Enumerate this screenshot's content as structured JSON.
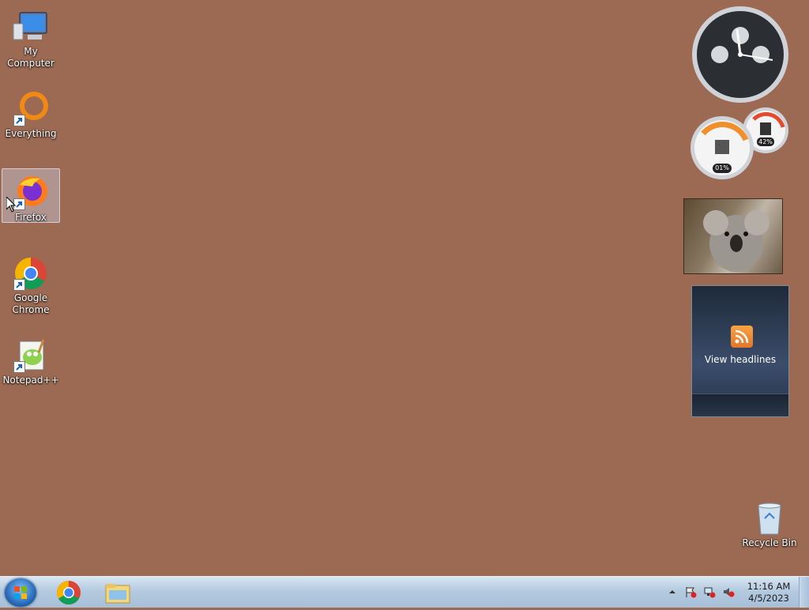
{
  "desktop": {
    "icons": [
      {
        "label": "My Computer",
        "icon": "computer-icon"
      },
      {
        "label": "Everything",
        "icon": "everything-icon"
      },
      {
        "label": "Firefox",
        "icon": "firefox-icon",
        "selected": true
      },
      {
        "label": "Google\nChrome",
        "icon": "chrome-icon"
      },
      {
        "label": "Notepad++",
        "icon": "notepad-plus-plus-icon"
      }
    ],
    "recycle_bin": {
      "label": "Recycle Bin",
      "icon": "recycle-bin-icon"
    }
  },
  "gadgets": {
    "cpu_meter": {
      "cpu": "01%",
      "memory": "42%"
    },
    "feed": {
      "label": "View headlines",
      "icon": "rss-icon"
    }
  },
  "taskbar": {
    "pinned": [
      "start-orb-icon",
      "chrome-icon",
      "file-explorer-icon"
    ],
    "tray_icons": [
      "show-hidden-icons-arrow",
      "action-center-flag-icon",
      "network-icon",
      "volume-muted-icon"
    ],
    "clock": {
      "time": "11:16 AM",
      "date": "4/5/2023"
    }
  },
  "colors": {
    "desktop_background": "#9c6a53"
  }
}
